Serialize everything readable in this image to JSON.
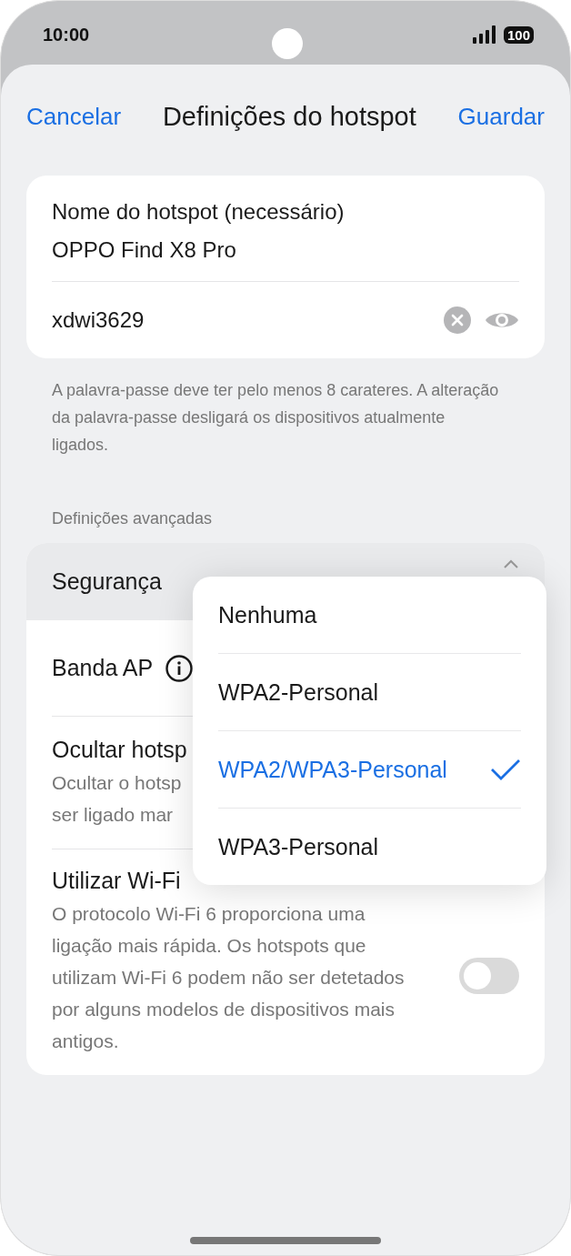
{
  "status_bar": {
    "time": "10:00",
    "battery": "100"
  },
  "header": {
    "cancel": "Cancelar",
    "title": "Definições do hotspot",
    "save": "Guardar"
  },
  "name_field": {
    "label": "Nome do hotspot (necessário)",
    "value": "OPPO Find X8 Pro"
  },
  "password_field": {
    "value": "xdwi3629"
  },
  "password_hint": "A palavra-passe deve ter pelo menos 8 carateres. A alteração da palavra-passe desligará os dispositivos atualmente ligados.",
  "advanced_heading": "Definições avançadas",
  "settings": [
    {
      "kind": "select",
      "label": "Segurança",
      "expanded": true
    },
    {
      "kind": "info",
      "label": "Banda AP"
    },
    {
      "kind": "text",
      "label": "Ocultar hotsp",
      "description_lines": [
        "Ocultar o hotsp",
        "ser ligado mar"
      ]
    },
    {
      "kind": "toggle",
      "label": "Utilizar Wi-Fi",
      "description": "O protocolo Wi-Fi 6 proporciona uma ligação mais rápida. Os hotspots que utilizam Wi-Fi 6 podem não ser detetados por alguns modelos de dispositivos mais antigos.",
      "on": false
    }
  ],
  "dropdown": {
    "options": [
      {
        "label": "Nenhuma",
        "selected": false
      },
      {
        "label": "WPA2-Personal",
        "selected": false
      },
      {
        "label": "WPA2/WPA3-Personal",
        "selected": true
      },
      {
        "label": "WPA3-Personal",
        "selected": false
      }
    ]
  }
}
